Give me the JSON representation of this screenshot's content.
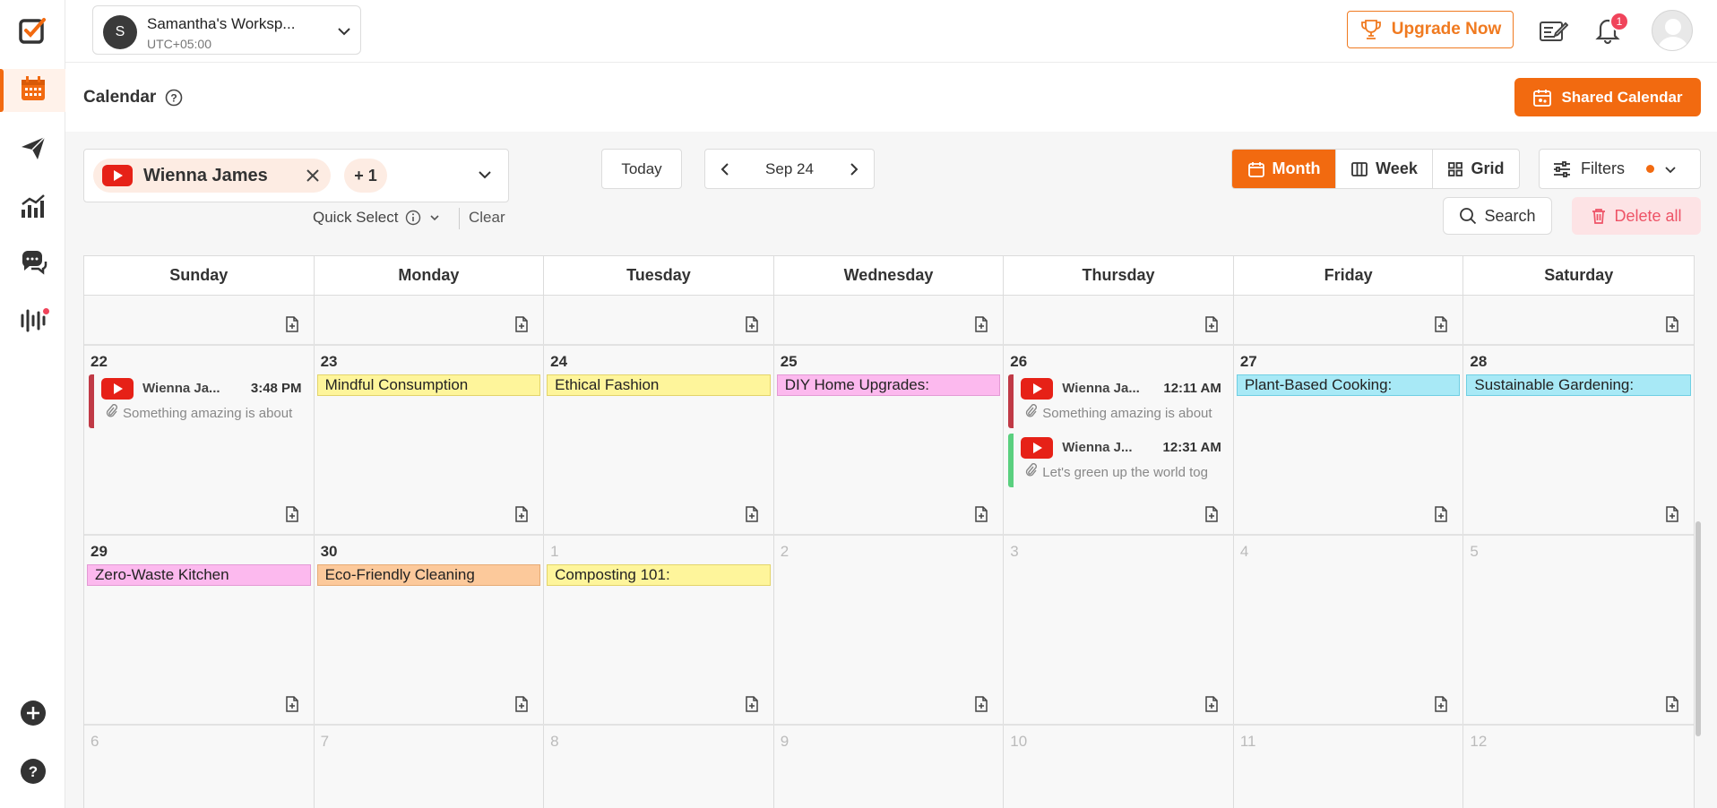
{
  "workspace": {
    "initial": "S",
    "name": "Samantha's Worksp...",
    "timezone": "UTC+05:00"
  },
  "topbar": {
    "upgrade_label": "Upgrade Now",
    "notification_count": "1"
  },
  "page": {
    "title": "Calendar",
    "shared_calendar_label": "Shared Calendar"
  },
  "toolbar": {
    "account_name": "Wienna James",
    "more_accounts": "+ 1",
    "quick_select": "Quick Select",
    "clear": "Clear",
    "today": "Today",
    "current_period": "Sep 24",
    "views": [
      "Month",
      "Week",
      "Grid"
    ],
    "active_view": "Month",
    "filters": "Filters",
    "search": "Search",
    "delete_all": "Delete all"
  },
  "calendar": {
    "weekdays": [
      "Sunday",
      "Monday",
      "Tuesday",
      "Wednesday",
      "Thursday",
      "Friday",
      "Saturday"
    ],
    "weeks": [
      {
        "days": [
          {
            "num": ""
          },
          {
            "num": ""
          },
          {
            "num": ""
          },
          {
            "num": ""
          },
          {
            "num": ""
          },
          {
            "num": ""
          },
          {
            "num": ""
          }
        ]
      },
      {
        "days": [
          {
            "num": "22",
            "posts": [
              {
                "account": "Wienna Ja...",
                "time": "3:48 PM",
                "text": "Something amazing is about",
                "accent": "red"
              }
            ]
          },
          {
            "num": "23",
            "notes": [
              {
                "text": "Mindful Consumption",
                "color": "yellow"
              }
            ]
          },
          {
            "num": "24",
            "notes": [
              {
                "text": "Ethical Fashion",
                "color": "yellow"
              }
            ]
          },
          {
            "num": "25",
            "notes": [
              {
                "text": "DIY Home Upgrades:",
                "color": "pink"
              }
            ]
          },
          {
            "num": "26",
            "posts": [
              {
                "account": "Wienna Ja...",
                "time": "12:11 AM",
                "text": "Something amazing is about",
                "accent": "red"
              },
              {
                "account": "Wienna J...",
                "time": "12:31 AM",
                "text": "Let's green up the world tog",
                "accent": "green"
              }
            ]
          },
          {
            "num": "27",
            "notes": [
              {
                "text": "Plant-Based Cooking:",
                "color": "cyan"
              }
            ]
          },
          {
            "num": "28",
            "notes": [
              {
                "text": "Sustainable Gardening:",
                "color": "cyan"
              }
            ]
          }
        ]
      },
      {
        "days": [
          {
            "num": "29",
            "notes": [
              {
                "text": "Zero-Waste Kitchen",
                "color": "pink"
              }
            ]
          },
          {
            "num": "30",
            "notes": [
              {
                "text": "Eco-Friendly Cleaning",
                "color": "orange"
              }
            ]
          },
          {
            "num": "1",
            "muted": true,
            "notes": [
              {
                "text": "Composting 101:",
                "color": "yellow"
              }
            ]
          },
          {
            "num": "2",
            "muted": true
          },
          {
            "num": "3",
            "muted": true
          },
          {
            "num": "4",
            "muted": true
          },
          {
            "num": "5",
            "muted": true
          }
        ]
      },
      {
        "days": [
          {
            "num": "6",
            "muted": true
          },
          {
            "num": "7",
            "muted": true
          },
          {
            "num": "8",
            "muted": true
          },
          {
            "num": "9",
            "muted": true
          },
          {
            "num": "10",
            "muted": true
          },
          {
            "num": "11",
            "muted": true
          },
          {
            "num": "12",
            "muted": true
          }
        ]
      }
    ]
  },
  "colors": {
    "accent": "#f26a10",
    "danger": "#ee5366",
    "youtube": "#e62117"
  }
}
